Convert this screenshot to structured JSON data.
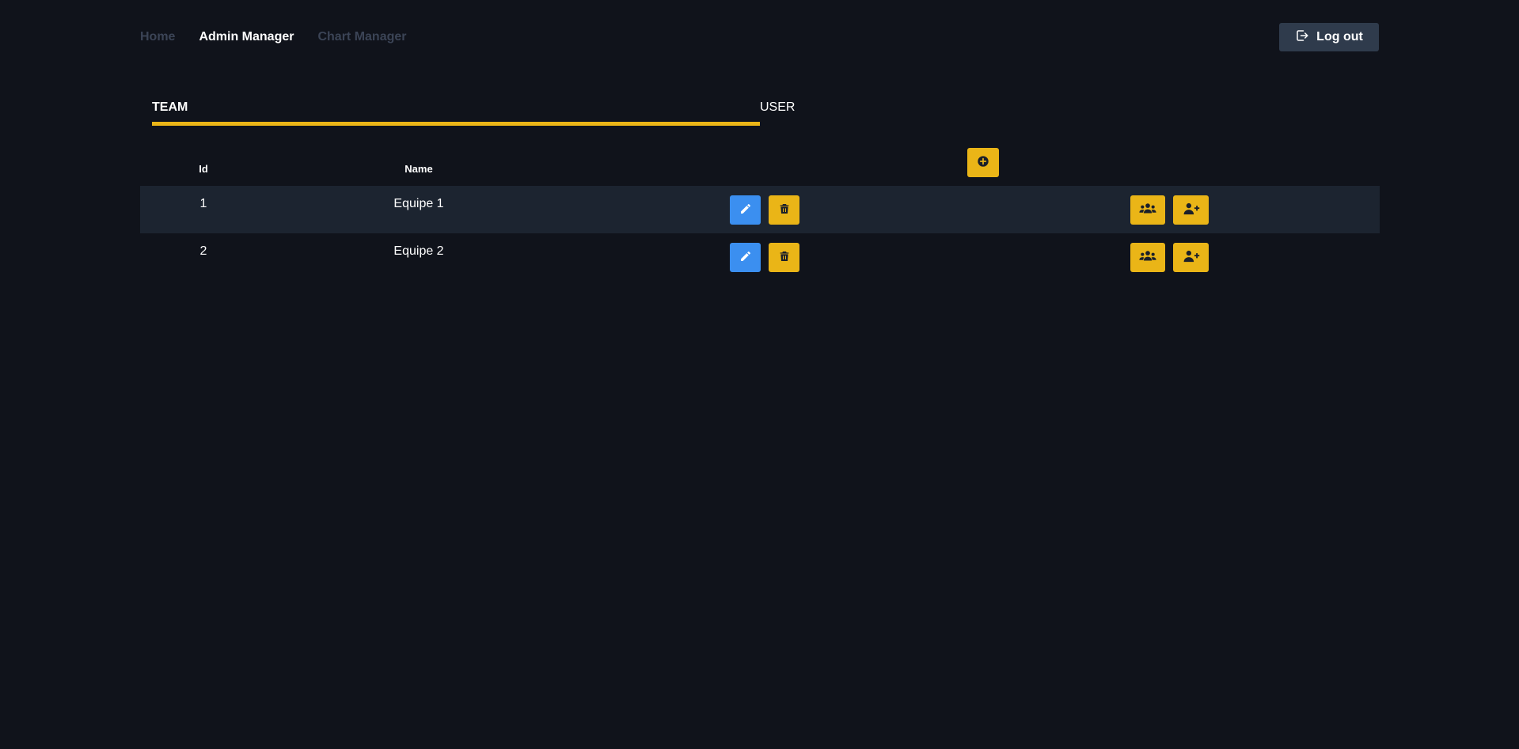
{
  "nav": {
    "links": [
      {
        "label": "Home"
      },
      {
        "label": "Admin Manager"
      },
      {
        "label": "Chart Manager"
      }
    ],
    "logout_label": "Log out"
  },
  "tabs": {
    "team": "TEAM",
    "user": "USER",
    "active": "TEAM"
  },
  "table": {
    "headers": {
      "id": "Id",
      "name": "Name"
    },
    "rows": [
      {
        "id": "1",
        "name": "Equipe 1"
      },
      {
        "id": "2",
        "name": "Equipe 2"
      }
    ]
  },
  "icons": {
    "logout": "logout-icon",
    "add": "plus-circle-icon",
    "edit": "pencil-icon",
    "delete": "trash-icon",
    "team": "users-icon",
    "add_user": "user-plus-icon"
  },
  "colors": {
    "background": "#10131b",
    "accent": "#eab517",
    "edit": "#3b8ff0",
    "stripe": "#1c2430",
    "logout_bg": "#2f3b4c",
    "nav_dim": "#3b4456"
  }
}
